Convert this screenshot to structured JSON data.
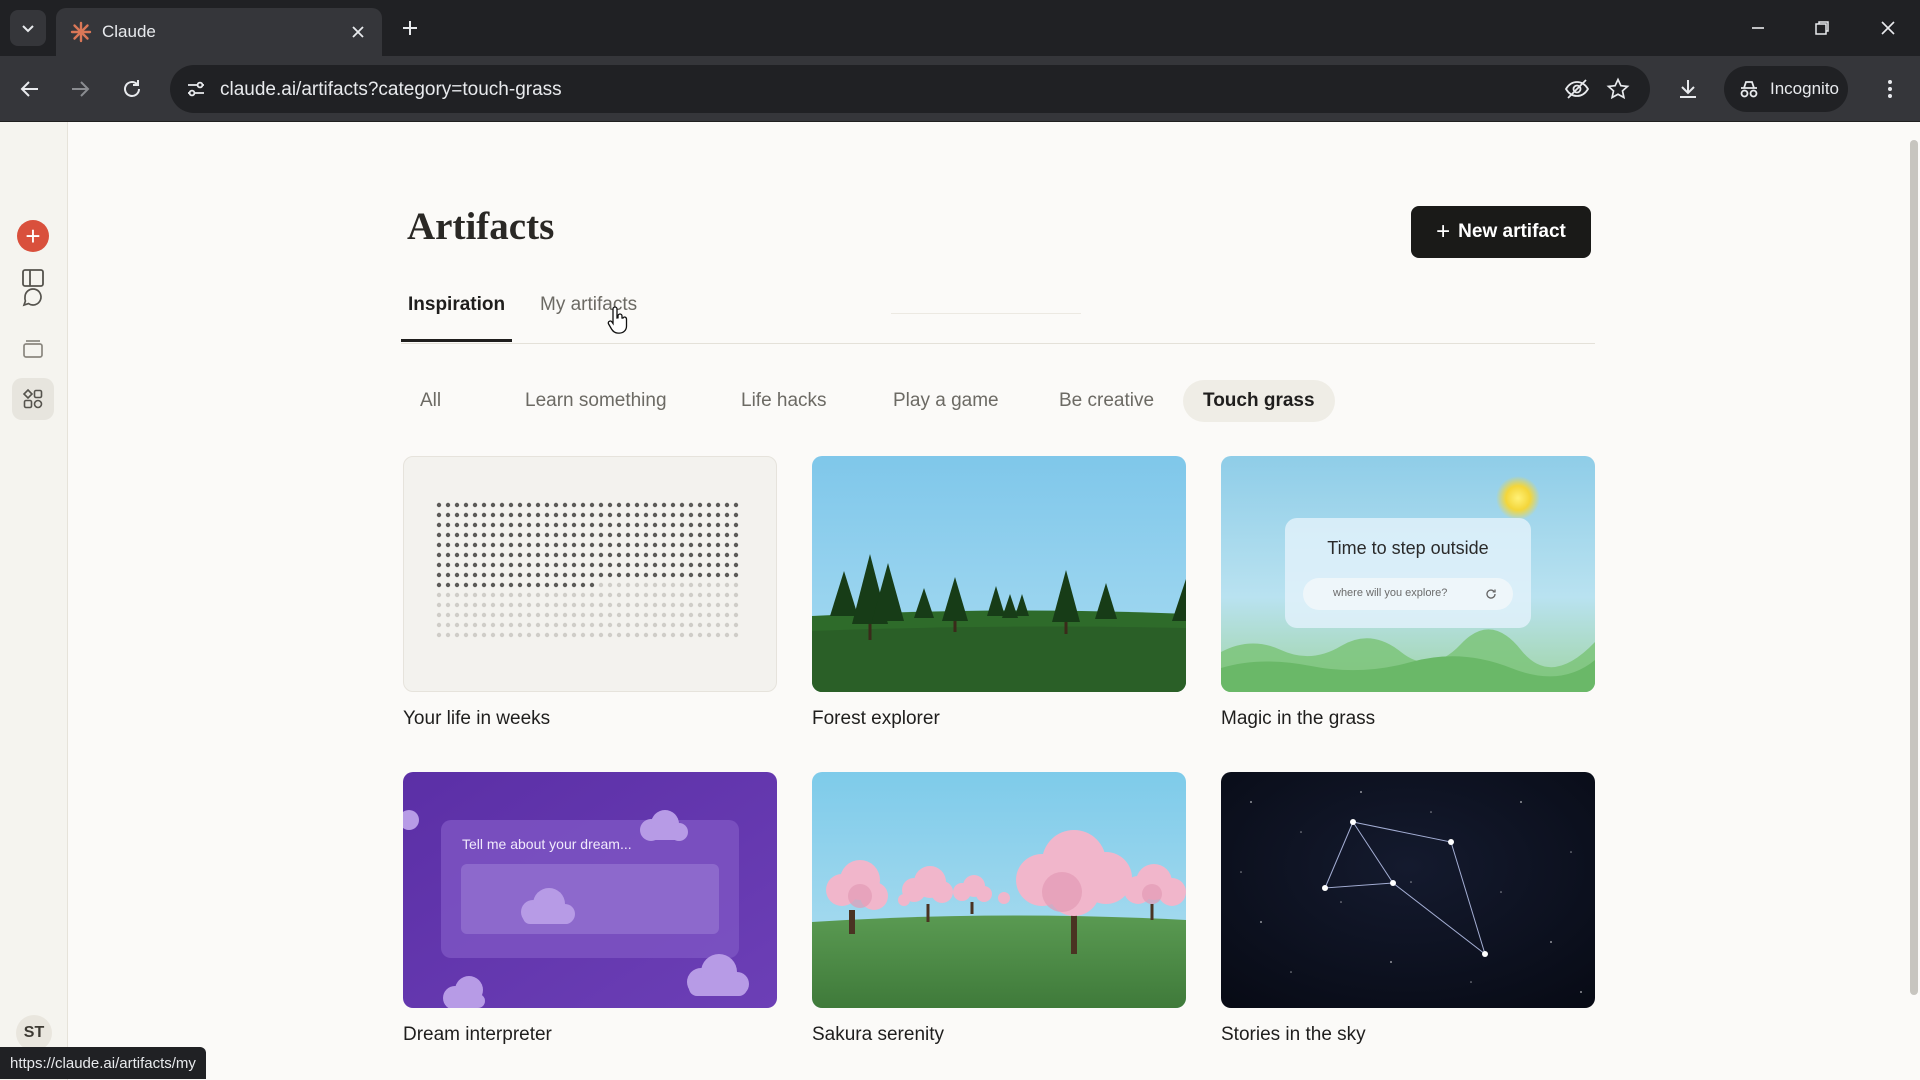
{
  "browser": {
    "tab_title": "Claude",
    "url": "claude.ai/artifacts?category=touch-grass",
    "incognito_label": "Incognito",
    "status_url": "https://claude.ai/artifacts/my"
  },
  "user": {
    "initials": "ST"
  },
  "page": {
    "title": "Artifacts",
    "new_button": "New artifact",
    "tabs": [
      "Inspiration",
      "My artifacts"
    ],
    "active_tab": "Inspiration",
    "categories": [
      "All",
      "Learn something",
      "Life hacks",
      "Play a game",
      "Be creative",
      "Touch grass"
    ],
    "active_category": "Touch grass"
  },
  "cards": [
    {
      "label": "Your life in weeks"
    },
    {
      "label": "Forest explorer"
    },
    {
      "label": "Magic in the grass",
      "heading": "Time to step outside",
      "input_placeholder": "where will you explore?"
    },
    {
      "label": "Dream interpreter",
      "prompt": "Tell me about your dream..."
    },
    {
      "label": "Sakura serenity"
    },
    {
      "label": "Stories in the sky"
    }
  ],
  "colors": {
    "accent": "#d9503c",
    "button_dark": "#1a1a18",
    "dream_purple": "#6a3fb0",
    "night_sky": "#0b0f1c"
  },
  "icons": [
    "tab-list-icon",
    "claude-logo-icon",
    "close-icon",
    "plus-icon",
    "minimize-icon",
    "restore-icon",
    "back-icon",
    "forward-icon",
    "reload-icon",
    "site-settings-icon",
    "eye-off-icon",
    "star-icon",
    "download-icon",
    "incognito-icon",
    "menu-icon",
    "sidebar-toggle-icon",
    "chat-icon",
    "projects-icon",
    "artifacts-icon"
  ]
}
